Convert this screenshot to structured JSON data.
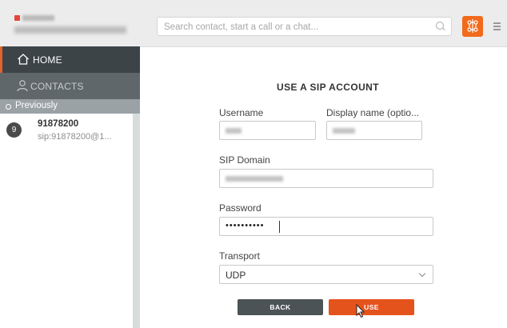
{
  "header": {
    "search_placeholder": "Search contact, start a call or a chat...",
    "accent_color": "#f26a1b"
  },
  "sidebar": {
    "home_label": "HOME",
    "contacts_label": "CONTACTS",
    "section_label": "Previously",
    "contacts": [
      {
        "initial": "9",
        "name": "91878200",
        "sip": "sip:91878200@1..."
      }
    ]
  },
  "form": {
    "title": "USE A SIP ACCOUNT",
    "username_label": "Username",
    "display_name_label": "Display name (optio...",
    "sip_domain_label": "SIP Domain",
    "password_label": "Password",
    "password_value": "••••••••••",
    "transport_label": "Transport",
    "transport_value": "UDP",
    "back_label": "BACK",
    "use_label": "USE"
  }
}
